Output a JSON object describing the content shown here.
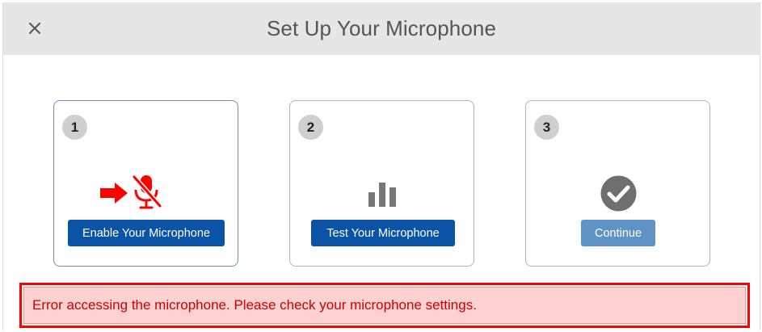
{
  "header": {
    "title": "Set Up Your Microphone",
    "close_icon": "close-icon"
  },
  "steps": [
    {
      "number": "1",
      "icon": "microphone-disabled-icon",
      "arrow_icon": "arrow-right-icon",
      "button_label": "Enable Your Microphone",
      "state": "active"
    },
    {
      "number": "2",
      "icon": "bar-chart-icon",
      "button_label": "Test Your Microphone",
      "state": "enabled"
    },
    {
      "number": "3",
      "icon": "checkmark-circle-icon",
      "button_label": "Continue",
      "state": "disabled"
    }
  ],
  "error": {
    "message": "Error accessing the microphone. Please check your microphone settings."
  },
  "colors": {
    "primary_button": "#0a53a6",
    "disabled_button": "#5f93c7",
    "error_text": "#cc0000",
    "error_bg": "#ffd1d1",
    "error_border": "#ff0000",
    "mic_error": "#ff0000"
  }
}
